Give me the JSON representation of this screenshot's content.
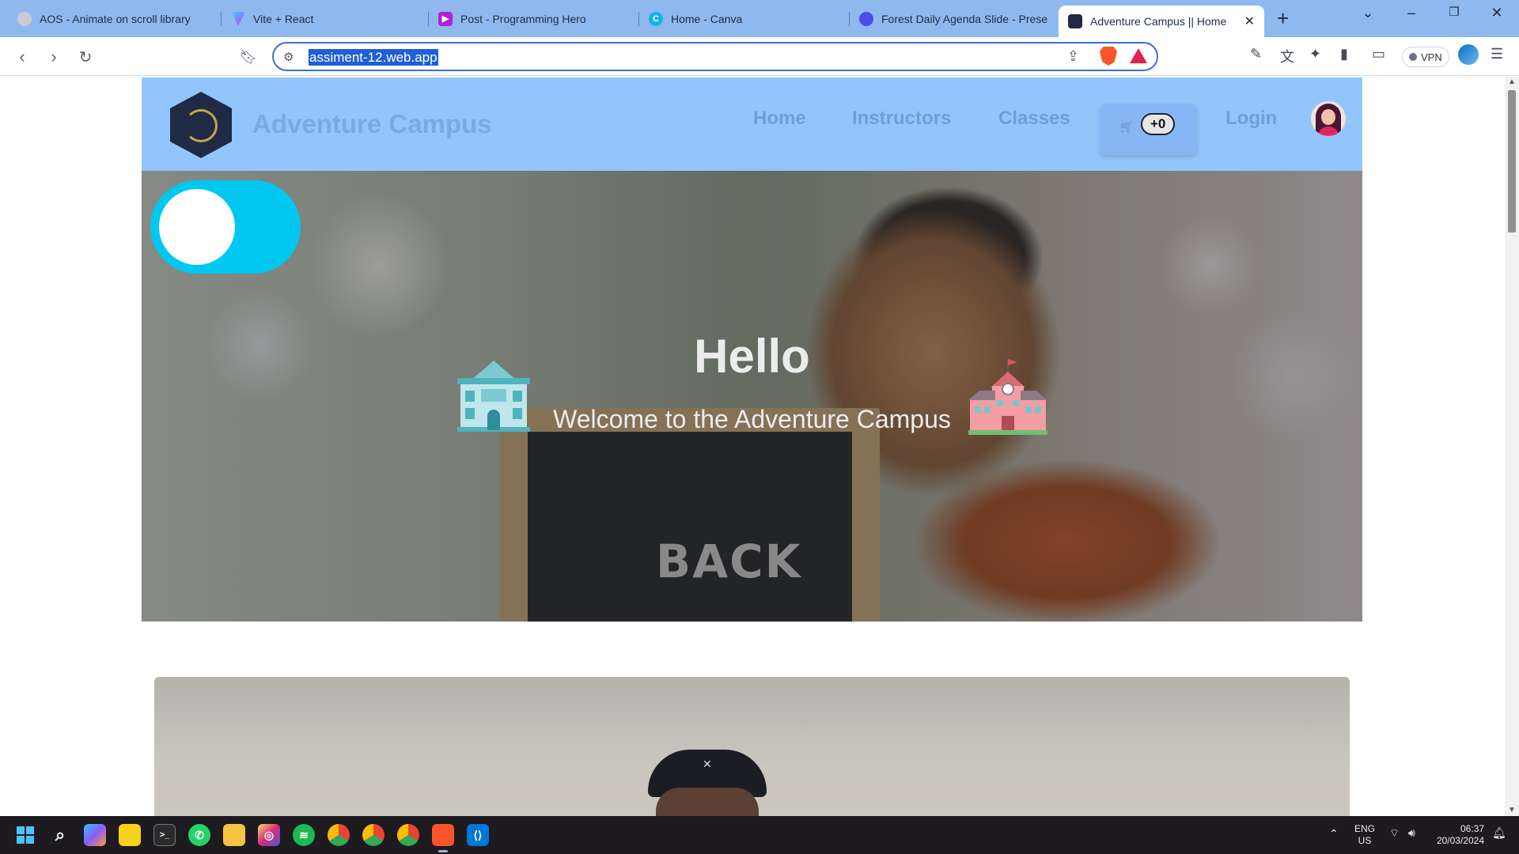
{
  "browser": {
    "tabs": [
      {
        "title": "AOS - Animate on scroll library",
        "color": "#c9cbd2"
      },
      {
        "title": "Vite + React",
        "color": "#8d5cf6"
      },
      {
        "title": "Post - Programming Hero",
        "color": "#b21fd4"
      },
      {
        "title": "Home - Canva",
        "color": "#13b3e0"
      },
      {
        "title": "Forest Daily Agenda Slide - Prese",
        "color": "#4a4ee8"
      },
      {
        "title": "Adventure Campus || Home",
        "color": "#1f2a44",
        "active": true
      }
    ],
    "new_tab_label": "+",
    "url": "assiment-12.web.app",
    "vpn_label": "VPN"
  },
  "site": {
    "brand": "Adventure Campus",
    "nav": {
      "home": "Home",
      "instructors": "Instructors",
      "classes": "Classes",
      "cart_count": "+0",
      "login": "Login"
    },
    "hero": {
      "title": "Hello",
      "subtitle": "Welcome to the Adventure Campus",
      "board_text": "BACK",
      "toggle_state": "off"
    }
  },
  "taskbar": {
    "lang_top": "ENG",
    "lang_bottom": "US",
    "time": "06:37",
    "date": "20/03/2024",
    "apps": [
      "windows-start",
      "search",
      "copilot",
      "sticky-notes",
      "terminal",
      "whatsapp",
      "file-explorer",
      "instagram",
      "spotify",
      "chrome-profile",
      "chrome",
      "chrome-alt",
      "brave",
      "vscode"
    ]
  },
  "colors": {
    "tabbar": "#8fb8ef",
    "site_nav": "#93c5fd",
    "toggle": "#00c8f0",
    "url_highlight": "#1f5fd6"
  }
}
